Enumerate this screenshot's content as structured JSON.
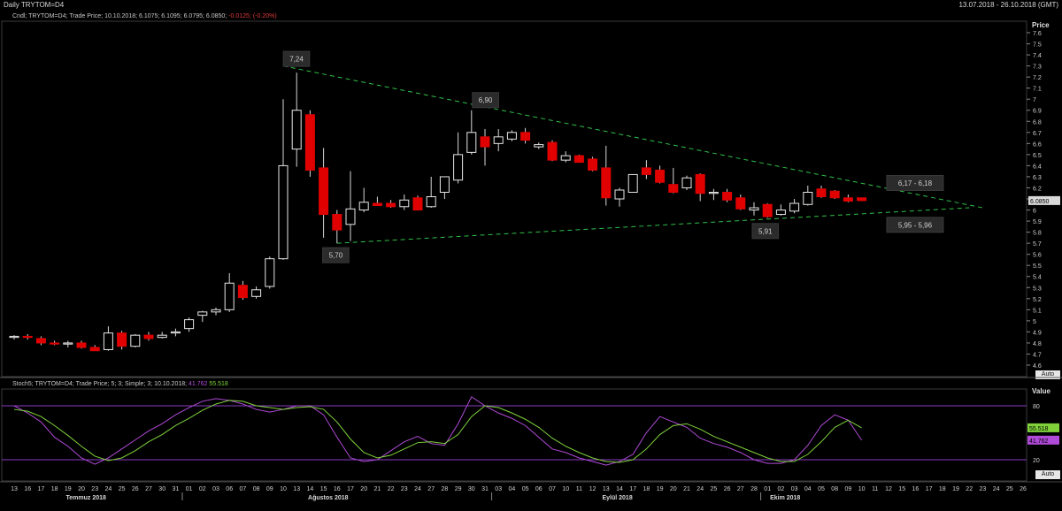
{
  "header": {
    "title": "Daily TRYTOM=D4",
    "date_range": "13.07.2018 - 26.10.2018 (GMT)"
  },
  "price_panel": {
    "legend_prefix": "Cndl; TRYTOM=D4; Trade Price; 10.10.2018; 6.1075; 6.1095; 6.0795; 6.0850;",
    "legend_change": "-0.0125; (-0.20%)",
    "axis_title": "Price",
    "last_price": "6.0850",
    "auto_label": "Auto",
    "y_ticks": [
      "4.6",
      "4.7",
      "4.8",
      "4.9",
      "5",
      "5.1",
      "5.2",
      "5.3",
      "5.4",
      "5.5",
      "5.6",
      "5.7",
      "5.8",
      "5.9",
      "6",
      "6.1",
      "6.2",
      "6.3",
      "6.4",
      "6.5",
      "6.6",
      "6.7",
      "6.8",
      "6.9",
      "7",
      "7.1",
      "7.2",
      "7.3",
      "7.4",
      "7.5",
      "7.6"
    ],
    "annotations": [
      "7,24",
      "6,90",
      "5,70",
      "5,91",
      "6,17 - 6,18",
      "5,95 - 5,96"
    ]
  },
  "stoch_panel": {
    "legend_prefix": "Stoch5; TRYTOM=D4; Trade Price;  5; 3; Simple; 3; 10.10.2018;",
    "legend_k": "41.762",
    "legend_d": "55.518",
    "axis_title": "Value",
    "y_ticks": [
      "20",
      "80"
    ],
    "auto_label": "Auto",
    "k_label": "41.762",
    "d_label": "55.518"
  },
  "x_axis": {
    "day_labels": [
      "13",
      "16",
      "17",
      "18",
      "19",
      "20",
      "23",
      "24",
      "25",
      "26",
      "27",
      "30",
      "31",
      "01",
      "02",
      "03",
      "06",
      "07",
      "08",
      "09",
      "10",
      "13",
      "14",
      "15",
      "16",
      "17",
      "20",
      "21",
      "22",
      "23",
      "24",
      "27",
      "28",
      "29",
      "30",
      "31",
      "03",
      "04",
      "05",
      "06",
      "07",
      "10",
      "11",
      "12",
      "13",
      "14",
      "17",
      "18",
      "19",
      "20",
      "21",
      "24",
      "25",
      "26",
      "27",
      "28",
      "01",
      "02",
      "03",
      "04",
      "05",
      "08",
      "09",
      "10",
      "11",
      "12",
      "15",
      "16",
      "17",
      "18",
      "19",
      "22",
      "23",
      "24",
      "25",
      "26"
    ],
    "month_labels": [
      "Temmuz 2018",
      "Ağustos 2018",
      "Eylül 2018",
      "Ekim 2018"
    ]
  },
  "colors": {
    "background": "#000000",
    "up_candle_fill": "#000000",
    "up_candle_stroke": "#e8e8e8",
    "down_candle_fill": "#e00000",
    "trendline": "#2fc24a",
    "stoch_k": "#b04ad8",
    "stoch_d": "#7fd23a",
    "stoch_bands": "#8a3cc4",
    "last_price_bg": "#d9d9d9"
  },
  "chart_data": [
    {
      "type": "candlestick",
      "series_name": "TRYTOM=D4",
      "ylim": [
        4.6,
        7.6
      ],
      "ohlc": [
        [
          4.85,
          4.87,
          4.83,
          4.86
        ],
        [
          4.86,
          4.88,
          4.83,
          4.85
        ],
        [
          4.84,
          4.86,
          4.78,
          4.8
        ],
        [
          4.8,
          4.82,
          4.78,
          4.79
        ],
        [
          4.79,
          4.82,
          4.76,
          4.8
        ],
        [
          4.8,
          4.82,
          4.75,
          4.76
        ],
        [
          4.76,
          4.78,
          4.73,
          4.73
        ],
        [
          4.74,
          4.95,
          4.73,
          4.89
        ],
        [
          4.89,
          4.91,
          4.74,
          4.77
        ],
        [
          4.77,
          4.88,
          4.76,
          4.87
        ],
        [
          4.87,
          4.9,
          4.82,
          4.84
        ],
        [
          4.85,
          4.9,
          4.84,
          4.87
        ],
        [
          4.89,
          4.93,
          4.86,
          4.9
        ],
        [
          4.93,
          5.03,
          4.9,
          5.01
        ],
        [
          5.05,
          5.09,
          4.99,
          5.08
        ],
        [
          5.08,
          5.12,
          5.05,
          5.1
        ],
        [
          5.1,
          5.43,
          5.08,
          5.34
        ],
        [
          5.32,
          5.36,
          5.19,
          5.21
        ],
        [
          5.22,
          5.31,
          5.2,
          5.28
        ],
        [
          5.31,
          5.58,
          5.29,
          5.56
        ],
        [
          5.56,
          7.0,
          5.55,
          6.4
        ],
        [
          6.55,
          7.24,
          6.39,
          6.9
        ],
        [
          6.86,
          6.9,
          6.3,
          6.36
        ],
        [
          6.38,
          6.56,
          5.75,
          5.96
        ],
        [
          5.96,
          6.0,
          5.7,
          5.82
        ],
        [
          5.87,
          6.35,
          5.72,
          6.01
        ],
        [
          6.0,
          6.2,
          5.98,
          6.07
        ],
        [
          6.06,
          6.12,
          6.05,
          6.04
        ],
        [
          6.06,
          6.09,
          6.02,
          6.03
        ],
        [
          6.03,
          6.14,
          6.0,
          6.09
        ],
        [
          6.11,
          6.13,
          6.0,
          6.0
        ],
        [
          6.03,
          6.3,
          6.02,
          6.12
        ],
        [
          6.16,
          6.3,
          6.1,
          6.3
        ],
        [
          6.27,
          6.7,
          6.24,
          6.5
        ],
        [
          6.52,
          6.9,
          6.5,
          6.7
        ],
        [
          6.66,
          6.73,
          6.4,
          6.57
        ],
        [
          6.6,
          6.73,
          6.53,
          6.66
        ],
        [
          6.64,
          6.72,
          6.62,
          6.7
        ],
        [
          6.7,
          6.74,
          6.6,
          6.63
        ],
        [
          6.57,
          6.61,
          6.55,
          6.59
        ],
        [
          6.61,
          6.63,
          6.44,
          6.45
        ],
        [
          6.45,
          6.53,
          6.43,
          6.49
        ],
        [
          6.49,
          6.5,
          6.43,
          6.43
        ],
        [
          6.46,
          6.48,
          6.35,
          6.36
        ],
        [
          6.38,
          6.58,
          6.04,
          6.11
        ],
        [
          6.1,
          6.2,
          6.03,
          6.18
        ],
        [
          6.16,
          6.32,
          6.16,
          6.32
        ],
        [
          6.38,
          6.45,
          6.28,
          6.32
        ],
        [
          6.36,
          6.4,
          6.24,
          6.25
        ],
        [
          6.23,
          6.38,
          6.15,
          6.16
        ],
        [
          6.2,
          6.31,
          6.18,
          6.29
        ],
        [
          6.32,
          6.33,
          6.08,
          6.15
        ],
        [
          6.15,
          6.19,
          6.09,
          6.16
        ],
        [
          6.16,
          6.19,
          6.07,
          6.09
        ],
        [
          6.11,
          6.14,
          6.0,
          6.01
        ],
        [
          6.0,
          6.07,
          5.95,
          6.02
        ],
        [
          6.05,
          6.06,
          5.93,
          5.94
        ],
        [
          5.96,
          6.05,
          5.95,
          6.0
        ],
        [
          5.99,
          6.1,
          5.97,
          6.06
        ],
        [
          6.05,
          6.22,
          6.04,
          6.16
        ],
        [
          6.19,
          6.22,
          6.11,
          6.12
        ],
        [
          6.17,
          6.18,
          6.1,
          6.11
        ],
        [
          6.11,
          6.14,
          6.07,
          6.08
        ],
        [
          6.11,
          6.11,
          6.08,
          6.085
        ]
      ],
      "trendlines": [
        {
          "from": [
            20,
            7.3
          ],
          "to": [
            72,
            6.02
          ]
        },
        {
          "from": [
            24,
            5.7
          ],
          "to": [
            71,
            6.02
          ]
        }
      ]
    },
    {
      "type": "line",
      "title": "Stoch5",
      "ylim": [
        0,
        100
      ],
      "bands": [
        20,
        80
      ],
      "series": [
        {
          "name": "%K",
          "values": [
            80,
            72,
            62,
            45,
            35,
            22,
            15,
            22,
            32,
            42,
            52,
            60,
            70,
            78,
            85,
            88,
            86,
            82,
            76,
            73,
            76,
            80,
            80,
            70,
            45,
            22,
            18,
            20,
            30,
            40,
            46,
            38,
            36,
            60,
            90,
            80,
            72,
            66,
            58,
            45,
            32,
            28,
            22,
            18,
            14,
            18,
            26,
            50,
            68,
            62,
            56,
            44,
            38,
            34,
            28,
            20,
            16,
            16,
            20,
            36,
            58,
            70,
            64,
            41.762
          ]
        },
        {
          "name": "%D",
          "values": [
            76,
            74,
            68,
            58,
            47,
            35,
            24,
            19,
            22,
            30,
            40,
            48,
            58,
            66,
            75,
            82,
            86,
            85,
            80,
            78,
            76,
            78,
            79,
            76,
            62,
            43,
            28,
            22,
            25,
            32,
            39,
            40,
            38,
            48,
            68,
            80,
            78,
            72,
            65,
            56,
            44,
            35,
            28,
            22,
            18,
            17,
            20,
            32,
            48,
            58,
            60,
            54,
            46,
            40,
            34,
            28,
            22,
            18,
            18,
            26,
            40,
            56,
            64,
            55.518
          ]
        }
      ]
    }
  ]
}
